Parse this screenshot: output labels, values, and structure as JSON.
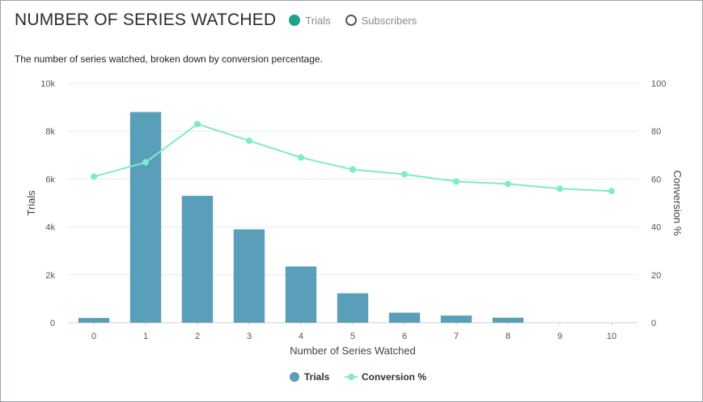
{
  "header": {
    "title": "NUMBER OF SERIES WATCHED",
    "toggles": [
      {
        "label": "Trials",
        "state": "selected",
        "color": "#1fa38a"
      },
      {
        "label": "Subscribers",
        "state": "unselected",
        "color": "#555555"
      }
    ]
  },
  "subtitle": "The number of series watched, broken down by conversion percentage.",
  "chart_data": {
    "type": "bar",
    "categories": [
      "0",
      "1",
      "2",
      "3",
      "4",
      "5",
      "6",
      "7",
      "8",
      "9",
      "10"
    ],
    "series": [
      {
        "name": "Trials",
        "type": "bar",
        "axis": "left",
        "color": "#5a9fba",
        "values": [
          200,
          8800,
          5300,
          3900,
          2350,
          1230,
          420,
          300,
          210,
          0,
          0
        ]
      },
      {
        "name": "Conversion %",
        "type": "line",
        "axis": "right",
        "color": "#7eecc9",
        "values": [
          61,
          67,
          83,
          76,
          69,
          64,
          62,
          59,
          58,
          56,
          55
        ]
      }
    ],
    "xlabel": "Number of Series Watched",
    "ylabel": "Trials",
    "y2label": "Conversion %",
    "ylim": [
      0,
      10000
    ],
    "y2lim": [
      0,
      100
    ],
    "yticks": [
      "0",
      "2k",
      "4k",
      "6k",
      "8k",
      "10k"
    ],
    "y2ticks": [
      "0",
      "20",
      "40",
      "60",
      "80",
      "100"
    ],
    "grid": true,
    "legend": "bottom-center"
  }
}
